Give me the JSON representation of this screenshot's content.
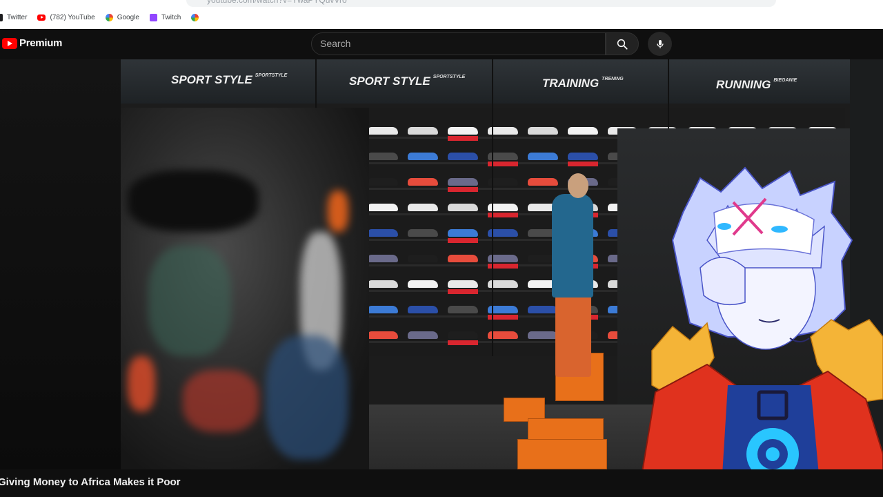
{
  "browser": {
    "address_text": "youtube.com/watch?v=YwaPYQuvVro",
    "bookmarks": [
      {
        "label": "Twitter",
        "icon": "twitter-icon"
      },
      {
        "label": "(782) YouTube",
        "icon": "youtube-icon"
      },
      {
        "label": "Google",
        "icon": "google-icon"
      },
      {
        "label": "Twitch",
        "icon": "twitch-icon"
      }
    ]
  },
  "header": {
    "logo_text": "Premium",
    "search_placeholder": "Search",
    "search_icon": "search-icon",
    "mic_icon": "microphone-icon"
  },
  "video": {
    "signs": [
      {
        "main": "SPORT STYLE",
        "sub": "SPORTSTYLE"
      },
      {
        "main": "SPORT STYLE",
        "sub": "SPORTSTYLE"
      },
      {
        "main": "TRAINING",
        "sub": "TRENING"
      },
      {
        "main": "RUNNING",
        "sub": "BIEGANIE"
      }
    ],
    "title": "Giving Money to Africa Makes it Poor"
  },
  "colors": {
    "youtube_red": "#ff0000",
    "background": "#0f0f0f",
    "sale_tag": "#d9262f",
    "shoe_box": "#e8701a"
  }
}
